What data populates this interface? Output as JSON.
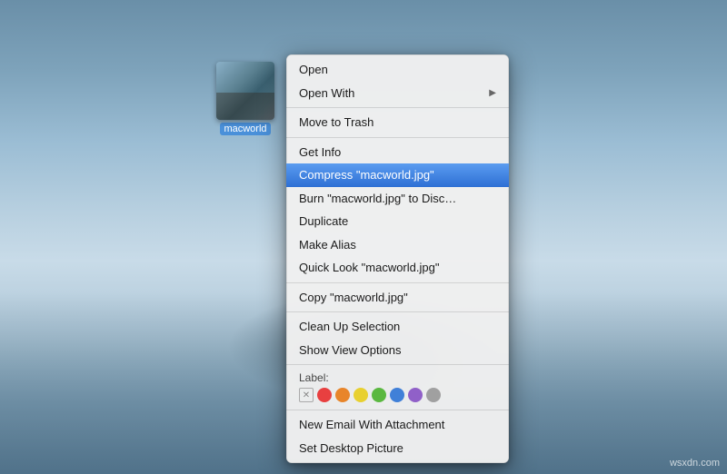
{
  "desktop": {
    "watermark": "wsxdn.com"
  },
  "file": {
    "name": "macworld",
    "label": "macworld"
  },
  "contextMenu": {
    "items": [
      {
        "id": "open",
        "label": "Open",
        "hasArrow": false,
        "separator_after": false,
        "highlighted": false,
        "disabled": false
      },
      {
        "id": "open-with",
        "label": "Open With",
        "hasArrow": true,
        "separator_after": false,
        "highlighted": false,
        "disabled": false
      },
      {
        "id": "sep1",
        "type": "separator"
      },
      {
        "id": "move-to-trash",
        "label": "Move to Trash",
        "hasArrow": false,
        "separator_after": false,
        "highlighted": false,
        "disabled": false
      },
      {
        "id": "sep2",
        "type": "separator"
      },
      {
        "id": "get-info",
        "label": "Get Info",
        "hasArrow": false,
        "separator_after": false,
        "highlighted": false,
        "disabled": false
      },
      {
        "id": "compress",
        "label": "Compress \"macworld.jpg\"",
        "hasArrow": false,
        "separator_after": false,
        "highlighted": true,
        "disabled": false
      },
      {
        "id": "burn",
        "label": "Burn \"macworld.jpg\" to Disc…",
        "hasArrow": false,
        "separator_after": false,
        "highlighted": false,
        "disabled": false
      },
      {
        "id": "duplicate",
        "label": "Duplicate",
        "hasArrow": false,
        "separator_after": false,
        "highlighted": false,
        "disabled": false
      },
      {
        "id": "make-alias",
        "label": "Make Alias",
        "hasArrow": false,
        "separator_after": false,
        "highlighted": false,
        "disabled": false
      },
      {
        "id": "quick-look",
        "label": "Quick Look \"macworld.jpg\"",
        "hasArrow": false,
        "separator_after": false,
        "highlighted": false,
        "disabled": false
      },
      {
        "id": "sep3",
        "type": "separator"
      },
      {
        "id": "copy",
        "label": "Copy \"macworld.jpg\"",
        "hasArrow": false,
        "separator_after": false,
        "highlighted": false,
        "disabled": false
      },
      {
        "id": "sep4",
        "type": "separator"
      },
      {
        "id": "clean-up",
        "label": "Clean Up Selection",
        "hasArrow": false,
        "separator_after": false,
        "highlighted": false,
        "disabled": false
      },
      {
        "id": "view-options",
        "label": "Show View Options",
        "hasArrow": false,
        "separator_after": false,
        "highlighted": false,
        "disabled": false
      },
      {
        "id": "sep5",
        "type": "separator"
      },
      {
        "id": "label",
        "type": "label"
      },
      {
        "id": "sep6",
        "type": "separator"
      },
      {
        "id": "new-email",
        "label": "New Email With Attachment",
        "hasArrow": false,
        "separator_after": false,
        "highlighted": false,
        "disabled": false
      },
      {
        "id": "set-desktop",
        "label": "Set Desktop Picture",
        "hasArrow": false,
        "separator_after": false,
        "highlighted": false,
        "disabled": false
      }
    ],
    "labelColors": [
      {
        "id": "red",
        "color": "#e84040"
      },
      {
        "id": "orange",
        "color": "#e8852a"
      },
      {
        "id": "yellow",
        "color": "#e8d030"
      },
      {
        "id": "green",
        "color": "#5ab840"
      },
      {
        "id": "blue",
        "color": "#4080d8"
      },
      {
        "id": "purple",
        "color": "#9060c8"
      },
      {
        "id": "gray",
        "color": "#a0a0a0"
      }
    ]
  }
}
